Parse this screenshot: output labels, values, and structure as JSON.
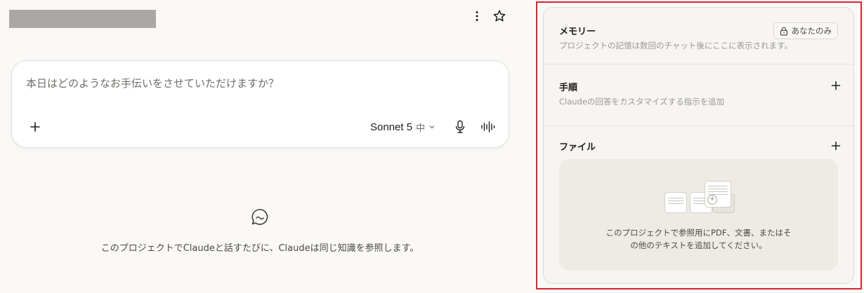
{
  "header": {
    "more_icon": "more-vertical-icon",
    "star_icon": "star-icon"
  },
  "composer": {
    "placeholder": "本日はどのようなお手伝いをさせていただけますか？",
    "model_name": "Sonnet 5",
    "model_effort": "中",
    "add_icon": "plus-icon",
    "mic_icon": "microphone-icon",
    "voice_icon": "voice-waveform-icon"
  },
  "empty_state": {
    "icon": "chat-bubble-icon",
    "text": "このプロジェクトでClaudeと話すたびに、Claudeは同じ知識を参照します。"
  },
  "panel": {
    "memory": {
      "title": "メモリー",
      "badge": "あなたのみ",
      "badge_icon": "lock-icon",
      "description": "プロジェクトの記憶は数回のチャット後にここに表示されます。"
    },
    "instructions": {
      "title": "手順",
      "description": "Claudeの回答をカスタマイズする指示を追加"
    },
    "files": {
      "title": "ファイル",
      "dropzone_line1": "このプロジェクトで参照用にPDF、文書、またはそ",
      "dropzone_line2": "の他のテキストを追加してください。"
    }
  },
  "colors": {
    "background": "#faf9f7",
    "panel": "#f6f5f1",
    "highlight": "#d6262b"
  }
}
